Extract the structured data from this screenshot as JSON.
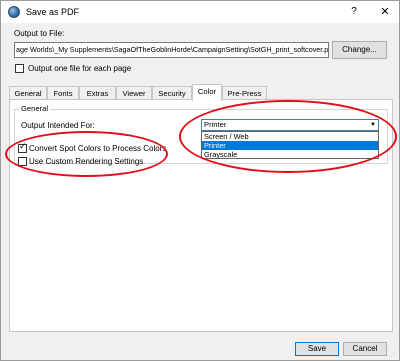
{
  "window": {
    "title": "Save as PDF",
    "help_label": "?",
    "close_label": "✕"
  },
  "output": {
    "label": "Output to File:",
    "path": "age Worlds\\_My Supplements\\SagaOfTheGoblinHorde\\CampaignSetting\\SotGH_print_softcover.pdf",
    "change_label": "Change...",
    "one_file_label": "Output one file for each page",
    "one_file_checked": false
  },
  "tabs": [
    {
      "label": "General",
      "active": false
    },
    {
      "label": "Fonts",
      "active": false
    },
    {
      "label": "Extras",
      "active": false
    },
    {
      "label": "Viewer",
      "active": false
    },
    {
      "label": "Security",
      "active": false
    },
    {
      "label": "Color",
      "active": true
    },
    {
      "label": "Pre-Press",
      "active": false
    }
  ],
  "color_tab": {
    "group_title": "General",
    "intended_label": "Output Intended For:",
    "selected_value": "Printer",
    "options": [
      {
        "label": "Screen / Web",
        "selected": false
      },
      {
        "label": "Printer",
        "selected": true
      },
      {
        "label": "Grayscale",
        "selected": false
      }
    ],
    "spot_colors_label": "Convert Spot Colors to Process Colors",
    "spot_colors_checked": true,
    "custom_render_label": "Use Custom Rendering Settings",
    "custom_render_checked": false
  },
  "buttons": {
    "save_label": "Save",
    "cancel_label": "Cancel"
  },
  "colors": {
    "highlight": "#0078d7",
    "annotation_red": "#e0101a"
  }
}
